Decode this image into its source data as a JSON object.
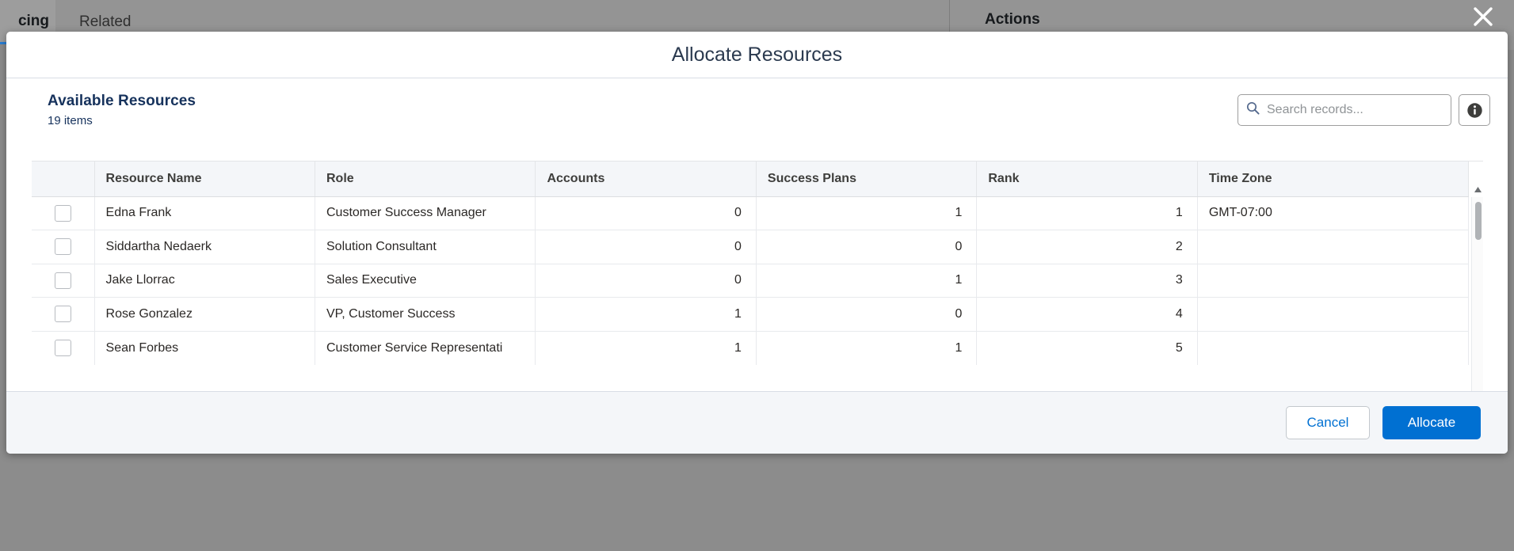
{
  "background": {
    "tab_financing": "cing",
    "tab_related": "Related",
    "panel_title": "Actions",
    "close_icon": "close-icon"
  },
  "modal": {
    "title": "Allocate Resources",
    "list": {
      "heading": "Available Resources",
      "count": "19 items",
      "search": {
        "placeholder": "Search records...",
        "value": "",
        "icon": "search-icon"
      },
      "info_button": {
        "icon": "info-icon",
        "glyph": "i"
      },
      "columns": [
        "",
        "Resource Name",
        "Role",
        "Accounts",
        "Success Plans",
        "Rank",
        "Time Zone"
      ],
      "rows": [
        {
          "selected": false,
          "resource_name": "Edna Frank",
          "role": "Customer Success Manager",
          "accounts": "0",
          "success_plans": "1",
          "rank": "1",
          "time_zone": "GMT-07:00"
        },
        {
          "selected": false,
          "resource_name": "Siddartha Nedaerk",
          "role": "Solution Consultant",
          "accounts": "0",
          "success_plans": "0",
          "rank": "2",
          "time_zone": ""
        },
        {
          "selected": false,
          "resource_name": "Jake Llorrac",
          "role": "Sales Executive",
          "accounts": "0",
          "success_plans": "1",
          "rank": "3",
          "time_zone": ""
        },
        {
          "selected": false,
          "resource_name": "Rose Gonzalez",
          "role": "VP, Customer Success",
          "accounts": "1",
          "success_plans": "0",
          "rank": "4",
          "time_zone": ""
        },
        {
          "selected": false,
          "resource_name": "Sean Forbes",
          "role": "Customer Service Representati",
          "accounts": "1",
          "success_plans": "1",
          "rank": "5",
          "time_zone": ""
        }
      ]
    },
    "footer": {
      "cancel_label": "Cancel",
      "allocate_label": "Allocate"
    }
  },
  "colors": {
    "primary": "#0070d2",
    "title_text": "#2b3a4f",
    "heading_text": "#16325c",
    "header_bg": "#f4f6f9",
    "backdrop": "#8c8c8c"
  }
}
